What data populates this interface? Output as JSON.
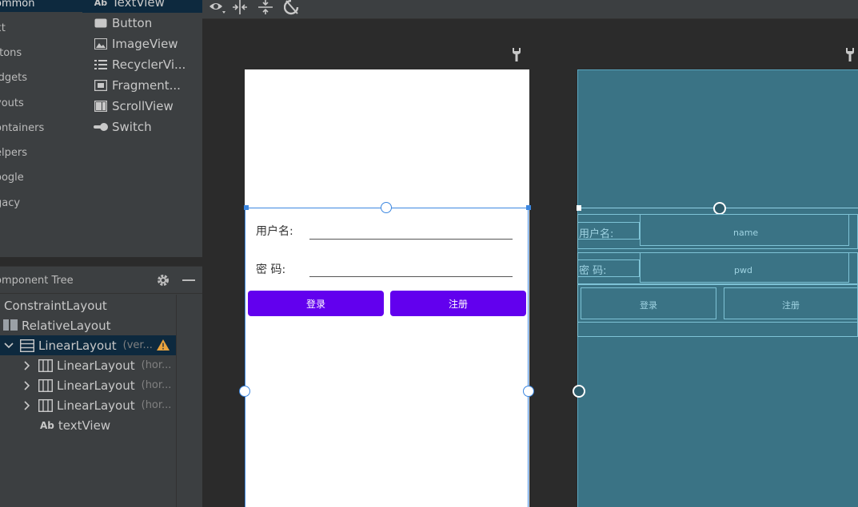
{
  "palette": {
    "categories": [
      "ommon",
      "xt",
      "ttons",
      "idgets",
      "youts",
      "ontainers",
      "elpers",
      "oogle",
      "gacy"
    ],
    "widgets": [
      {
        "label": "TextView",
        "icon": "text-ab-icon"
      },
      {
        "label": "Button",
        "icon": "button-icon"
      },
      {
        "label": "ImageView",
        "icon": "image-icon"
      },
      {
        "label": "RecyclerVi...",
        "icon": "list-icon"
      },
      {
        "label": "Fragment...",
        "icon": "fragment-icon"
      },
      {
        "label": "ScrollView",
        "icon": "scroll-icon"
      },
      {
        "label": "Switch",
        "icon": "switch-icon"
      }
    ]
  },
  "tree": {
    "title": "omponent Tree",
    "rows": [
      {
        "label": "ConstraintLayout",
        "hint": ""
      },
      {
        "label": "RelativeLayout",
        "hint": ""
      },
      {
        "label": "LinearLayout",
        "hint": "(ver..."
      },
      {
        "label": "LinearLayout",
        "hint": "(hor..."
      },
      {
        "label": "LinearLayout",
        "hint": "(hor..."
      },
      {
        "label": "LinearLayout",
        "hint": "(hor..."
      },
      {
        "label": "textView",
        "hint": ""
      }
    ]
  },
  "design": {
    "username_label": "用户名:",
    "password_label": "密    码:",
    "login_button": "登录",
    "register_button": "注册"
  },
  "blueprint": {
    "username_label": "用户名:",
    "password_label": "密    码:",
    "name_hint": "name",
    "pwd_hint": "pwd",
    "login_button": "登录",
    "register_button": "注册"
  },
  "colors": {
    "accent": "#6200ee",
    "selection": "#3c87e0",
    "blueprint": "#3a7385",
    "warning": "#e8a33d"
  }
}
